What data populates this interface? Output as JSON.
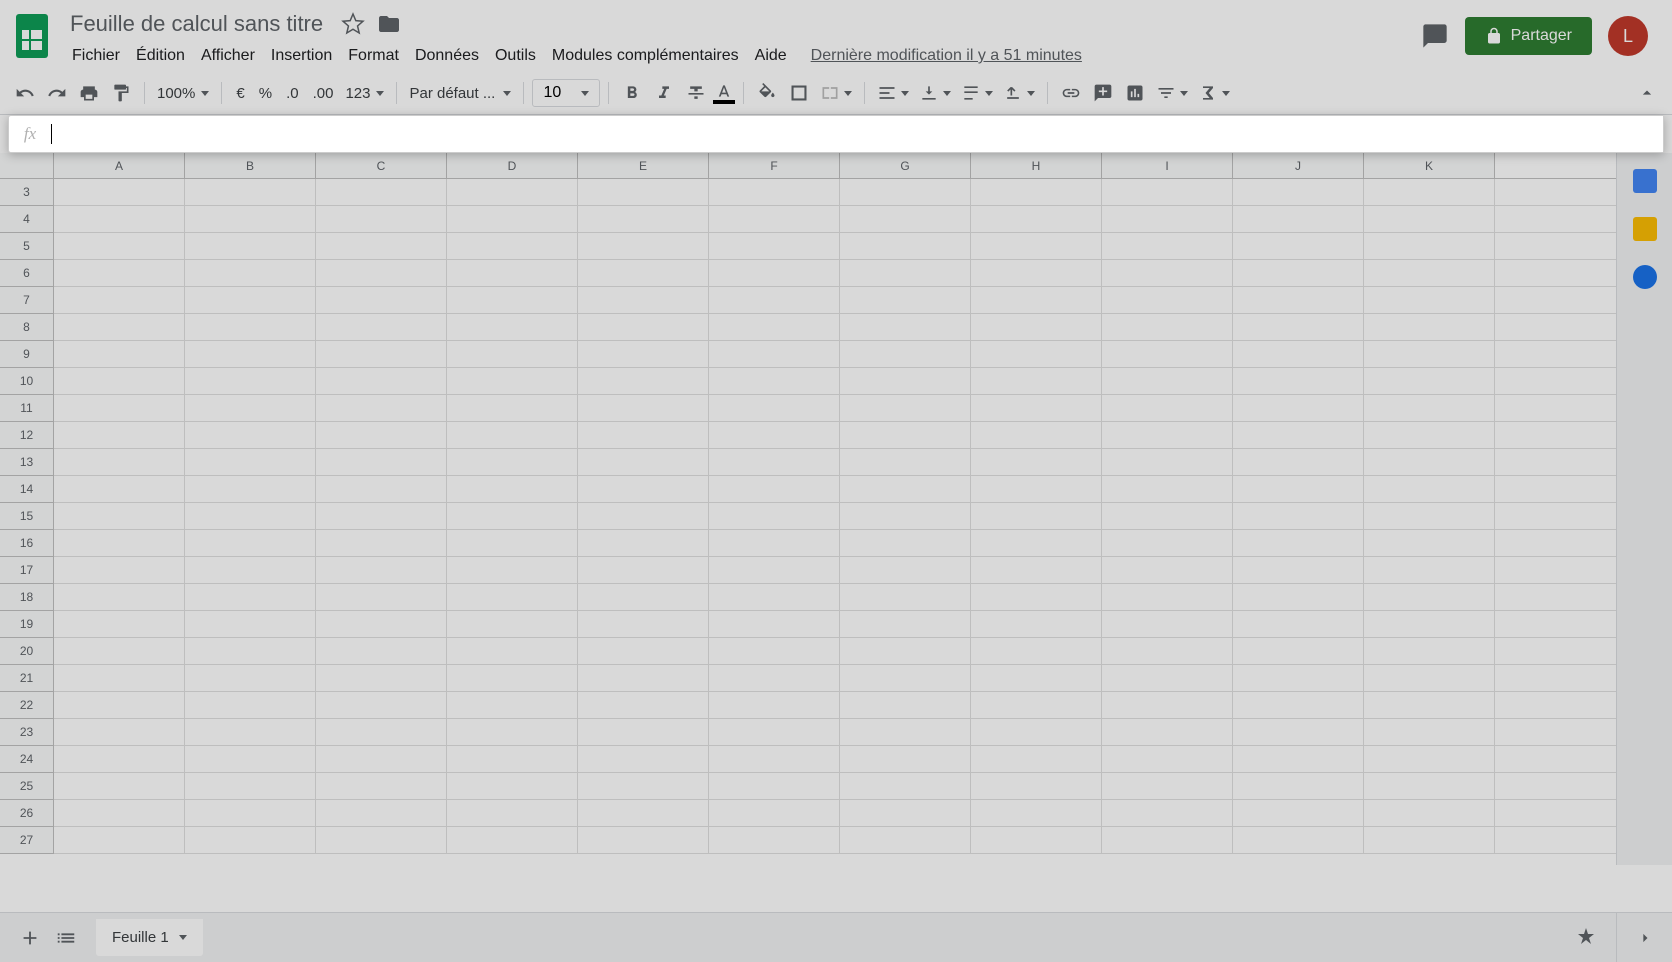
{
  "doc": {
    "title": "Feuille de calcul sans titre"
  },
  "menu": {
    "items": [
      "Fichier",
      "Édition",
      "Afficher",
      "Insertion",
      "Format",
      "Données",
      "Outils",
      "Modules complémentaires",
      "Aide"
    ],
    "last_edit": "Dernière modification il y a 51 minutes"
  },
  "header": {
    "share_label": "Partager",
    "avatar_initial": "L"
  },
  "toolbar": {
    "zoom": "100%",
    "currency": "€",
    "percent": "%",
    "dec_dec": ".0",
    "inc_dec": ".00",
    "num_fmt": "123",
    "font": "Par défaut ...",
    "font_size": "10"
  },
  "formula": {
    "value": ""
  },
  "grid": {
    "columns": [
      "A",
      "B",
      "C",
      "D",
      "E",
      "F",
      "G",
      "H",
      "I",
      "J",
      "K"
    ],
    "row_start": 3,
    "row_end": 27
  },
  "sheet_tab": {
    "name": "Feuille 1"
  }
}
